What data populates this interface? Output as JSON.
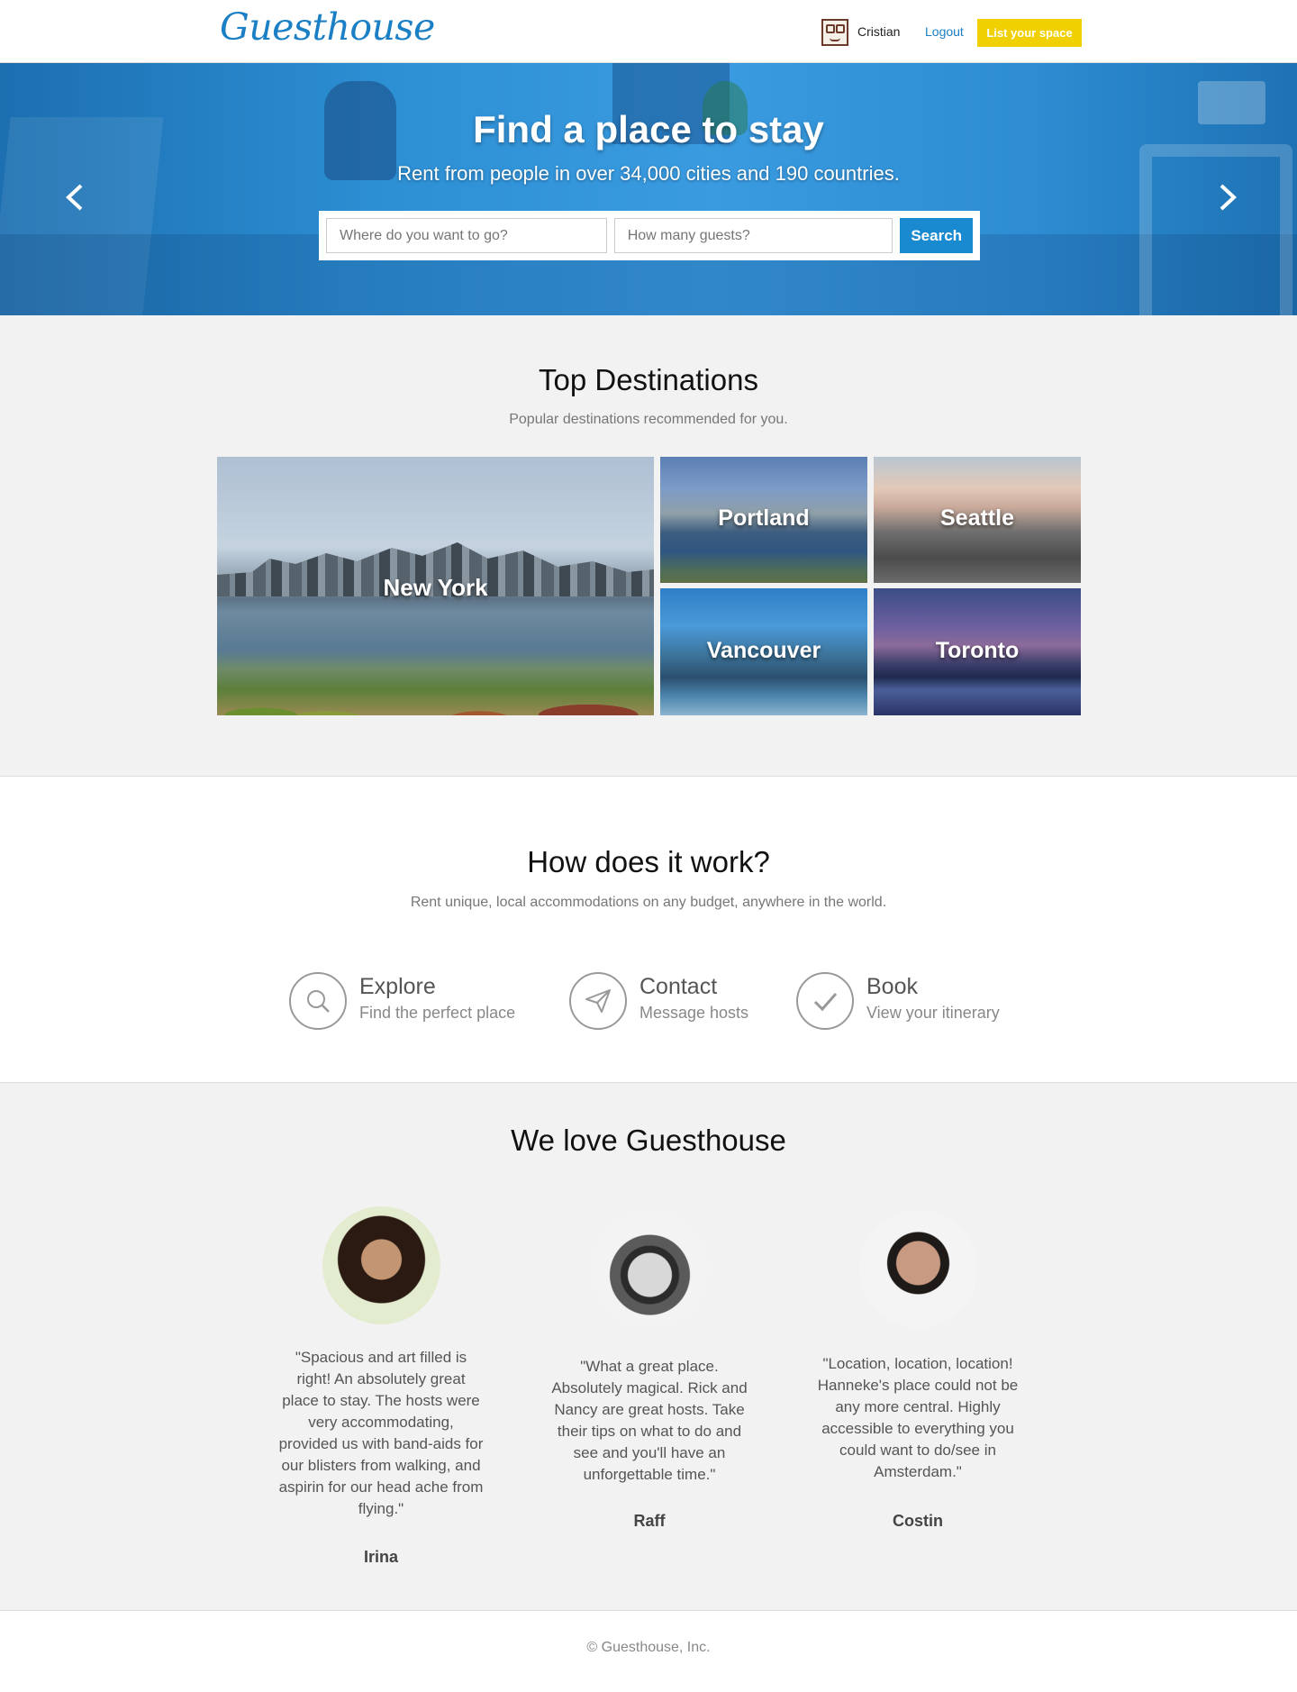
{
  "header": {
    "logo": "Guesthouse",
    "user_name": "Cristian",
    "logout_label": "Logout",
    "list_space_label": "List your space"
  },
  "hero": {
    "title": "Find a place to stay",
    "subtitle": "Rent from people in over 34,000 cities and 190 countries.",
    "where_placeholder": "Where do you want to go?",
    "guests_placeholder": "How many guests?",
    "search_label": "Search"
  },
  "destinations": {
    "title": "Top Destinations",
    "subtitle": "Popular destinations recommended for you.",
    "cities": [
      "New York",
      "Portland",
      "Seattle",
      "Vancouver",
      "Toronto"
    ]
  },
  "how": {
    "title": "How does it work?",
    "subtitle": "Rent unique, local accommodations on any budget, anywhere in the world.",
    "steps": [
      {
        "title": "Explore",
        "sub": "Find the perfect place",
        "icon": "search-icon"
      },
      {
        "title": "Contact",
        "sub": "Message hosts",
        "icon": "paper-plane-icon"
      },
      {
        "title": "Book",
        "sub": "View your itinerary",
        "icon": "checkmark-icon"
      }
    ]
  },
  "love": {
    "title": "We love Guesthouse",
    "testimonials": [
      {
        "quote": "\"Spacious and art filled is right! An absolutely great place to stay. The hosts were very accommodating, provided us with band-aids for our blisters from walking, and aspirin for our head ache from flying.\"",
        "name": "Irina"
      },
      {
        "quote": "\"What a great place. Absolutely magical. Rick and Nancy are great hosts. Take their tips on what to do and see and you'll have an unforgettable time.\"",
        "name": "Raff"
      },
      {
        "quote": "\"Location, location, location! Hanneke's place could not be any more central. Highly accessible to everything you could want to do/see in Amsterdam.\"",
        "name": "Costin"
      }
    ]
  },
  "footer": {
    "copyright": "© Guesthouse, Inc."
  },
  "colors": {
    "brand_blue": "#1a7fc4",
    "cta_yellow": "#f0d000",
    "search_button": "#1a8ad0"
  }
}
